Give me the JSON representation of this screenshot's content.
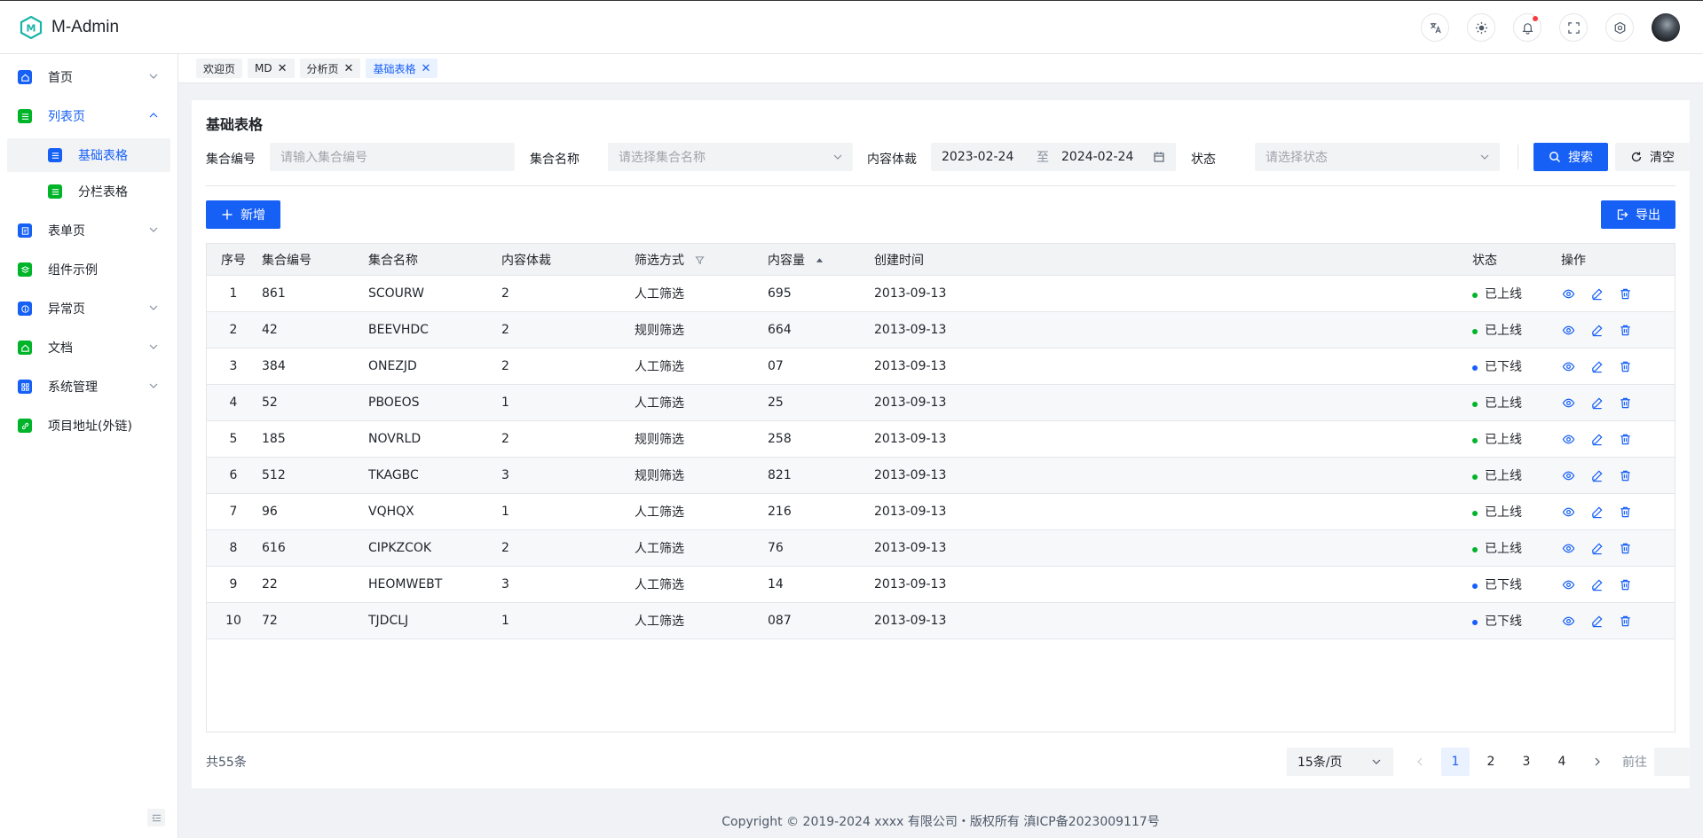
{
  "app": {
    "title": "M-Admin"
  },
  "colors": {
    "primary": "#1760f6",
    "menu_icon_blue": "#1760f6",
    "menu_icon_green": "#00b42a",
    "online": "#00b42a",
    "offline": "#165dff"
  },
  "header": {
    "icons": [
      "translate-icon",
      "theme-icon",
      "bell-icon",
      "fullscreen-icon",
      "settings-icon"
    ],
    "has_notification": true
  },
  "sidebar": {
    "items": [
      {
        "label": "首页",
        "icon": "home-icon",
        "color": "blue",
        "expandable": true,
        "expanded": false
      },
      {
        "label": "列表页",
        "icon": "list-icon",
        "color": "green",
        "expandable": true,
        "expanded": true,
        "children": [
          {
            "label": "基础表格",
            "icon": "list-icon",
            "color": "blue",
            "active": true
          },
          {
            "label": "分栏表格",
            "icon": "list-icon",
            "color": "green",
            "active": false
          }
        ]
      },
      {
        "label": "表单页",
        "icon": "form-icon",
        "color": "blue",
        "expandable": true,
        "expanded": false
      },
      {
        "label": "组件示例",
        "icon": "layers-icon",
        "color": "green",
        "expandable": false
      },
      {
        "label": "异常页",
        "icon": "info-icon",
        "color": "blue",
        "expandable": true,
        "expanded": false
      },
      {
        "label": "文档",
        "icon": "doc-icon",
        "color": "green",
        "expandable": true,
        "expanded": false
      },
      {
        "label": "系统管理",
        "icon": "grid-icon",
        "color": "blue",
        "expandable": true,
        "expanded": false
      },
      {
        "label": "项目地址(外链)",
        "icon": "link-icon",
        "color": "green",
        "expandable": false
      }
    ]
  },
  "tabs": [
    {
      "label": "欢迎页",
      "closable": false,
      "active": false
    },
    {
      "label": "MD",
      "closable": true,
      "active": false
    },
    {
      "label": "分析页",
      "closable": true,
      "active": false
    },
    {
      "label": "基础表格",
      "closable": true,
      "active": true
    }
  ],
  "page": {
    "title": "基础表格",
    "filters": {
      "code_label": "集合编号",
      "code_placeholder": "请输入集合编号",
      "name_label": "集合名称",
      "name_placeholder": "请选择集合名称",
      "format_label": "内容体裁",
      "date_start": "2023-02-24",
      "date_sep": "至",
      "date_end": "2024-02-24",
      "status_label": "状态",
      "status_placeholder": "请选择状态",
      "search_label": "搜索",
      "clear_label": "清空"
    },
    "toolbar": {
      "add_label": "新增",
      "export_label": "导出"
    }
  },
  "table": {
    "columns": [
      "序号",
      "集合编号",
      "集合名称",
      "内容体裁",
      "筛选方式",
      "内容量",
      "创建时间",
      "状态",
      "操作"
    ],
    "rows": [
      {
        "idx": "1",
        "code": "861",
        "name": "SCOURW",
        "format": "2",
        "filter": "人工筛选",
        "qty": "695",
        "time": "2013-09-13",
        "status": "已上线",
        "online": true
      },
      {
        "idx": "2",
        "code": "42",
        "name": "BEEVHDC",
        "format": "2",
        "filter": "规则筛选",
        "qty": "664",
        "time": "2013-09-13",
        "status": "已上线",
        "online": true
      },
      {
        "idx": "3",
        "code": "384",
        "name": "ONEZJD",
        "format": "2",
        "filter": "人工筛选",
        "qty": "07",
        "time": "2013-09-13",
        "status": "已下线",
        "online": false
      },
      {
        "idx": "4",
        "code": "52",
        "name": "PBOEOS",
        "format": "1",
        "filter": "人工筛选",
        "qty": "25",
        "time": "2013-09-13",
        "status": "已上线",
        "online": true
      },
      {
        "idx": "5",
        "code": "185",
        "name": "NOVRLD",
        "format": "2",
        "filter": "规则筛选",
        "qty": "258",
        "time": "2013-09-13",
        "status": "已上线",
        "online": true
      },
      {
        "idx": "6",
        "code": "512",
        "name": "TKAGBC",
        "format": "3",
        "filter": "规则筛选",
        "qty": "821",
        "time": "2013-09-13",
        "status": "已上线",
        "online": true
      },
      {
        "idx": "7",
        "code": "96",
        "name": "VQHQX",
        "format": "1",
        "filter": "人工筛选",
        "qty": "216",
        "time": "2013-09-13",
        "status": "已上线",
        "online": true
      },
      {
        "idx": "8",
        "code": "616",
        "name": "CIPKZCOK",
        "format": "2",
        "filter": "人工筛选",
        "qty": "76",
        "time": "2013-09-13",
        "status": "已上线",
        "online": true
      },
      {
        "idx": "9",
        "code": "22",
        "name": "HEOMWEBT",
        "format": "3",
        "filter": "人工筛选",
        "qty": "14",
        "time": "2013-09-13",
        "status": "已下线",
        "online": false
      },
      {
        "idx": "10",
        "code": "72",
        "name": "TJDCLJ",
        "format": "1",
        "filter": "人工筛选",
        "qty": "087",
        "time": "2013-09-13",
        "status": "已下线",
        "online": false
      }
    ]
  },
  "pagination": {
    "total_text": "共55条",
    "page_size": "15条/页",
    "pages": [
      "1",
      "2",
      "3",
      "4"
    ],
    "current": "1",
    "jump_label": "前往"
  },
  "footer": {
    "text": "Copyright © 2019-2024 xxxx 有限公司・版权所有 滇ICP备2023009117号"
  }
}
